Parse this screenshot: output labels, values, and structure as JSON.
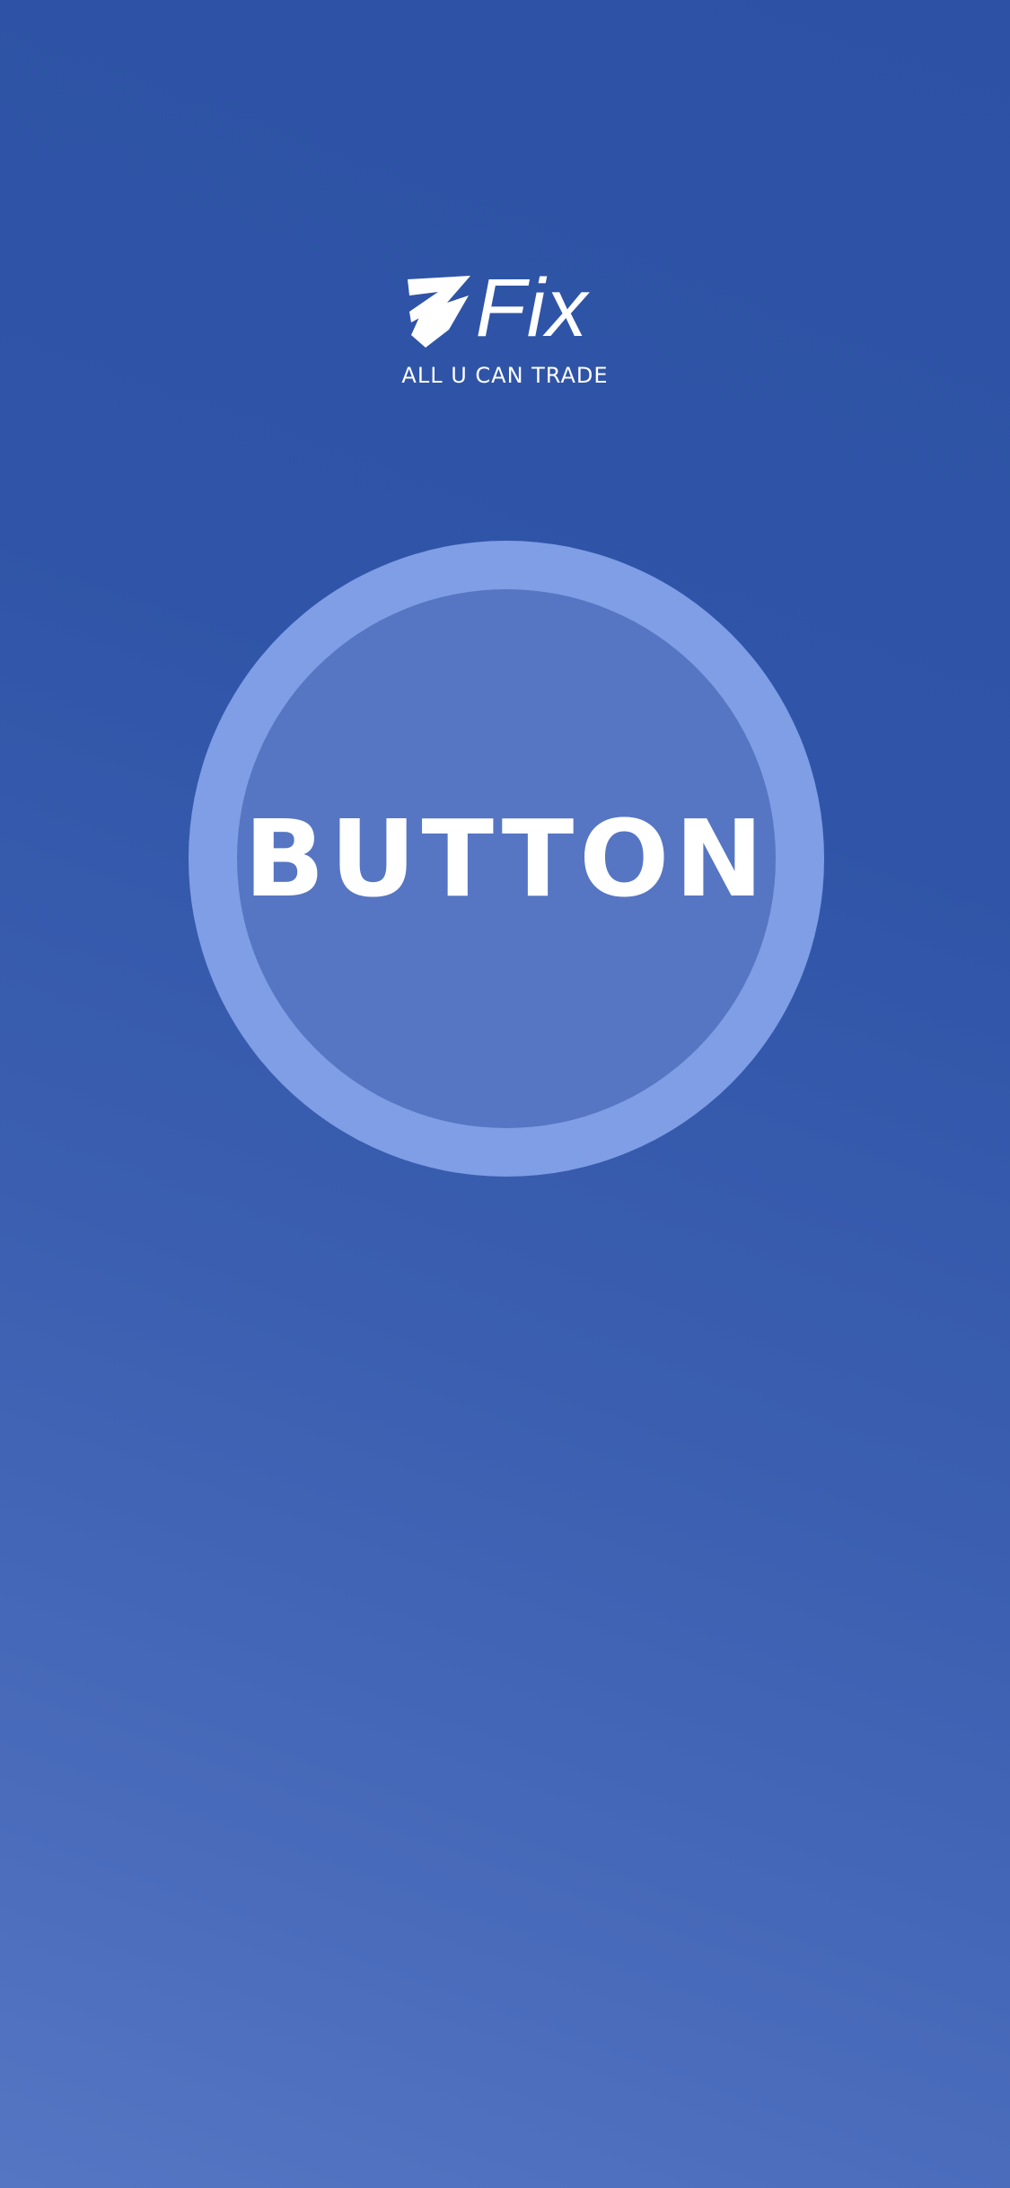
{
  "brand": {
    "logo_text": "Fix",
    "tagline": "ALL U CAN TRADE"
  },
  "main": {
    "button_label": "BUTTON"
  },
  "colors": {
    "background_top": "#2d52a5",
    "background_bottom": "#5476c3",
    "button_ring": "#7f9ee5",
    "button_fill": "#5676c4",
    "text": "#ffffff"
  },
  "icons": {
    "logo_mark": "z-swoosh-logo-icon"
  }
}
